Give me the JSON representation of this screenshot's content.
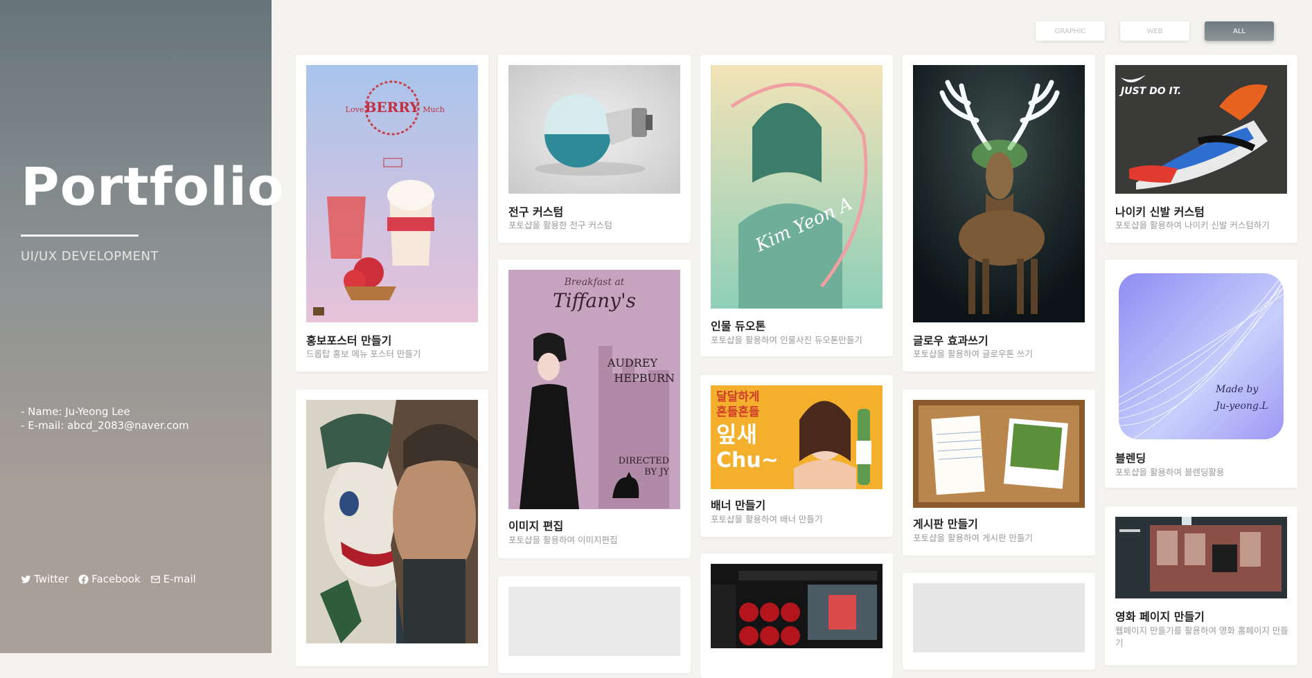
{
  "sidebar": {
    "logo": "Portfolio",
    "subtitle": "UI/UX DEVELOPMENT",
    "name_line": "- Name: Ju-Yeong Lee",
    "email_line": "- E-mail: abcd_2083@naver.com",
    "social": [
      {
        "label": "Twitter",
        "icon": "twitter-icon"
      },
      {
        "label": "Facebook",
        "icon": "facebook-icon"
      },
      {
        "label": "E-mail",
        "icon": "mail-icon"
      }
    ]
  },
  "filters": [
    {
      "label": "GRAPHIC",
      "active": false
    },
    {
      "label": "WEB",
      "active": false
    },
    {
      "label": "ALL",
      "active": true
    }
  ],
  "cards": [
    {
      "title": "홍보포스터 만들기",
      "desc": "드롭탑 홍보 메뉴 포스터 만들기",
      "thumb_text": {
        "word": "BERRY",
        "left": "Love",
        "right": "Much"
      }
    },
    {
      "title": "전구 커스텀",
      "desc": "포토샵을 활용한 전구 커스텀"
    },
    {
      "title": "인물 듀오톤",
      "desc": "포토샵을 활용하여 인물사진 듀오톤만들기",
      "thumb_text": {
        "signature": "Kim Yeon A"
      }
    },
    {
      "title": "글로우 효과쓰기",
      "desc": "포토샵을 활용하여 글로우톤 쓰기"
    },
    {
      "title": "나이키 신발 커스텀",
      "desc": "포토샵을 활용하여 나이키 신발 커스텀하기",
      "thumb_text": {
        "slogan": "JUST DO IT."
      }
    },
    {
      "title": "이미지 편집",
      "desc": "포토샵을 활용하여 이미지편집",
      "thumb_text": {
        "top": "Breakfast at",
        "main": "Tiffany's",
        "name1": "AUDREY",
        "name2": "HEPBURN",
        "dir1": "DIRECTED",
        "dir2": "BY JY"
      }
    },
    {
      "title": "배너 만들기",
      "desc": "포토샵을 활용하여 배너 만들기",
      "thumb_text": {
        "line1": "달달하게",
        "line2": "흔들흔들",
        "line3": "잎새",
        "line4": "Chu~"
      }
    },
    {
      "title": "게시판 만들기",
      "desc": "포토샵을 활용하여 게시판 만들기"
    },
    {
      "title": "블렌딩",
      "desc": "포토샵을 활용하여 블렌딩활용",
      "thumb_text": {
        "line1": "Made by",
        "line2": "Ju-yeong.L"
      }
    },
    {
      "title": "영화 페이지 만들기",
      "desc": "웹페이지 만들기를 활용하여 영화 홈페이지 만들기"
    }
  ],
  "colors": {
    "sidebar_top": "#67757a",
    "sidebar_bottom": "#aaa09a",
    "page_bg": "#f4f3ef",
    "filter_active": "#7a878b"
  }
}
